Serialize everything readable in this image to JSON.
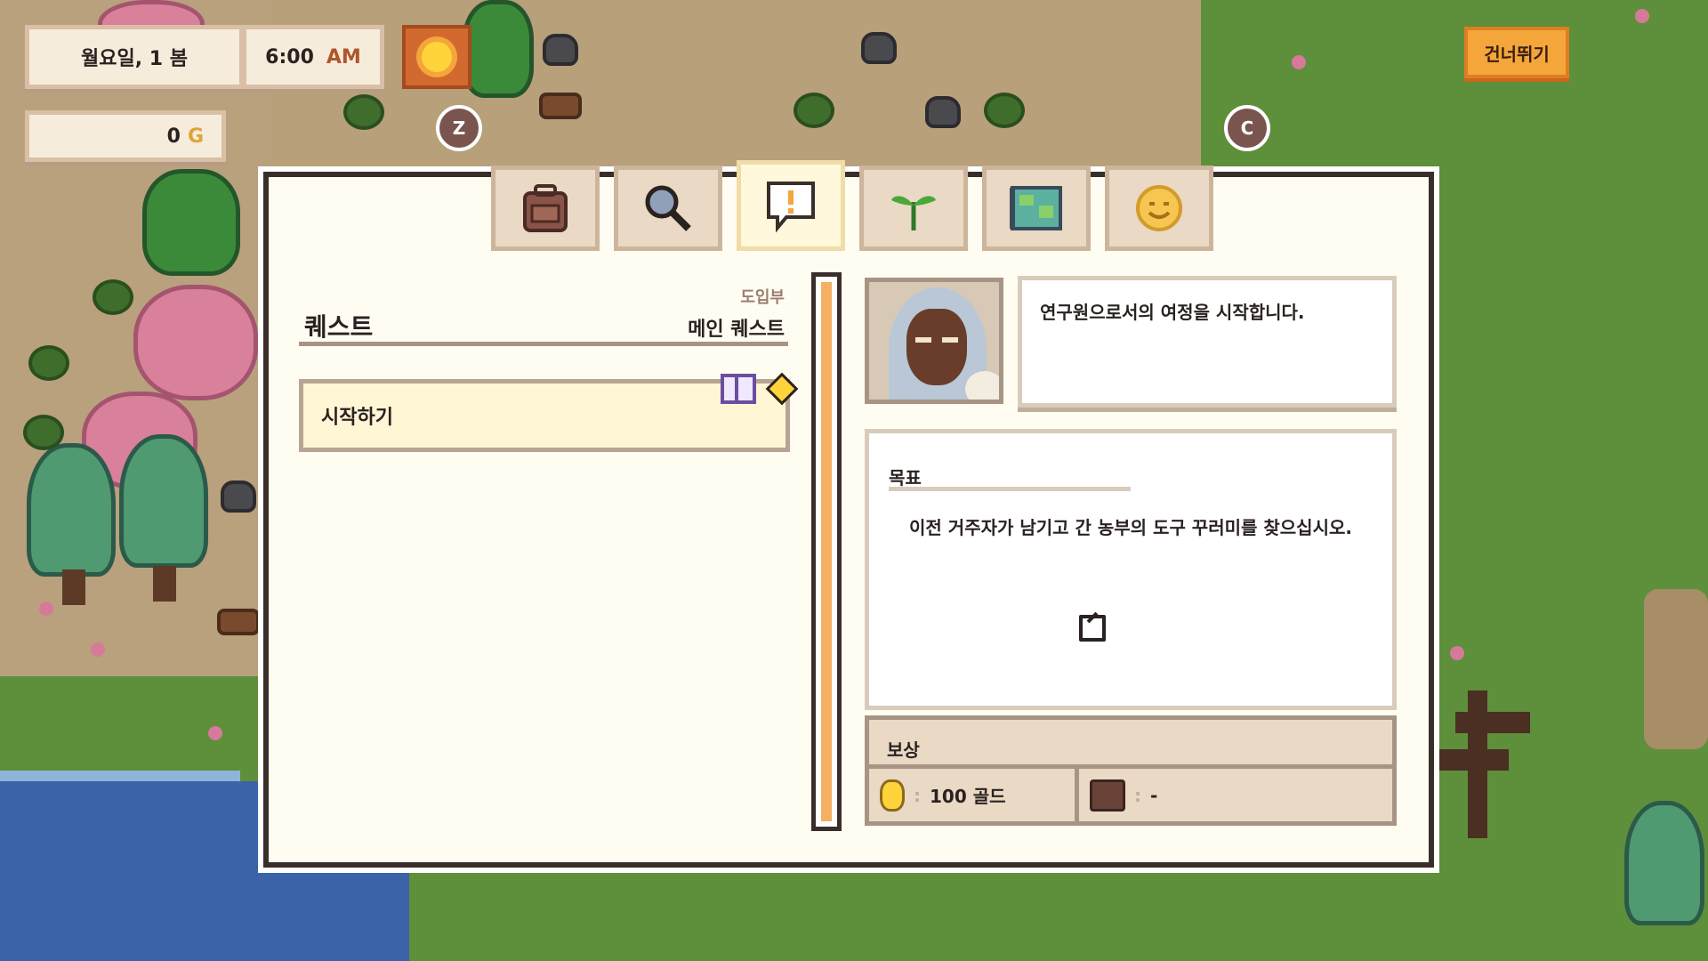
{
  "hud": {
    "date": "월요일, 1 봄",
    "time": "6:00",
    "ampm": "AM",
    "gold_amount": "0",
    "gold_unit": "G",
    "key_z": "Z",
    "key_c": "C",
    "skip_label": "건너뛰기"
  },
  "tabs": [
    {
      "name": "inventory",
      "icon": "backpack-icon",
      "active": false
    },
    {
      "name": "search",
      "icon": "magnifier-icon",
      "active": false
    },
    {
      "name": "quests",
      "icon": "speech-alert-icon",
      "active": true
    },
    {
      "name": "crops",
      "icon": "sprout-icon",
      "active": false
    },
    {
      "name": "map",
      "icon": "map-icon",
      "active": false
    },
    {
      "name": "relationships",
      "icon": "smile-face-icon",
      "active": false
    }
  ],
  "quest_list": {
    "title": "퀘스트",
    "category": "도입부",
    "type": "메인 퀘스트",
    "items": [
      {
        "label": "시작하기"
      }
    ]
  },
  "quest_detail": {
    "description": "연구원으로서의 여정을 시작합니다.",
    "objective_label": "목표",
    "objective_text": "이전 거주자가 남기고 간 농부의 도구 꾸러미를 찾으십시오.",
    "reward_label": "보상",
    "reward_gold": "100 골드",
    "reward_item": "-"
  },
  "colors": {
    "panel_bg": "#fffdf2",
    "accent_orange": "#f4a63a",
    "scroll_thumb": "#f4b063",
    "grass": "#5e8f3b"
  }
}
